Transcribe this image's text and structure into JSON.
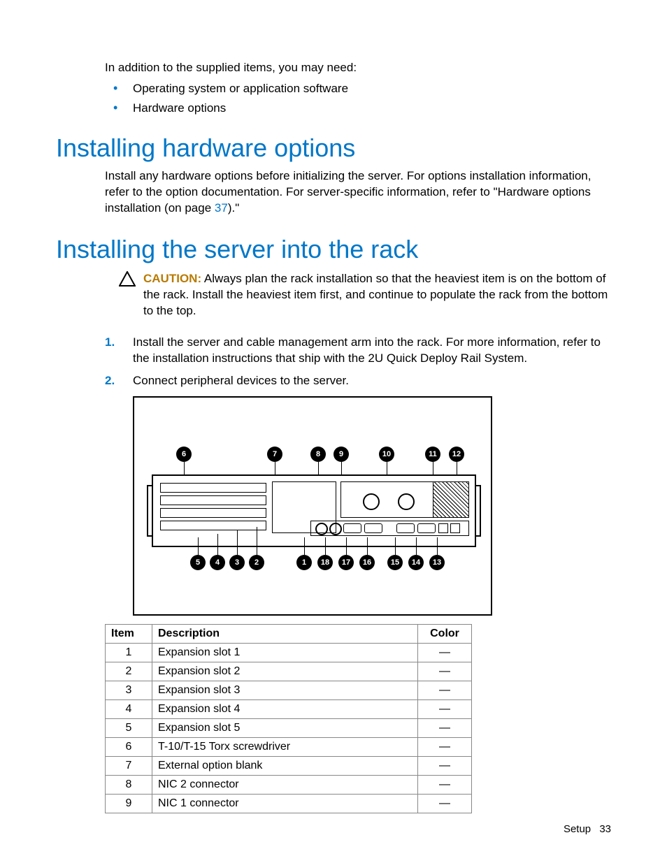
{
  "intro": {
    "lead": "In addition to the supplied items, you may need:",
    "bullets": [
      "Operating system or application software",
      "Hardware options"
    ]
  },
  "section1": {
    "heading": "Installing hardware options",
    "body_a": "Install any hardware options before initializing the server. For options installation information, refer to the option documentation. For server-specific information, refer to \"Hardware options installation (on page ",
    "link": "37",
    "body_b": ").\""
  },
  "section2": {
    "heading": "Installing the server into the rack",
    "caution_label": "CAUTION:",
    "caution_text": " Always plan the rack installation so that the heaviest item is on the bottom of the rack. Install the heaviest item first, and continue to populate the rack from the bottom to the top.",
    "steps": [
      "Install the server and cable management arm into the rack. For more information, refer to the installation instructions that ship with the 2U Quick Deploy Rail System.",
      "Connect peripheral devices to the server."
    ]
  },
  "callouts_top": [
    "6",
    "7",
    "8",
    "9",
    "10",
    "11",
    "12"
  ],
  "callouts_bottom_left": [
    "5",
    "4",
    "3",
    "2"
  ],
  "callouts_bottom_right": [
    "1",
    "18",
    "17",
    "16",
    "15",
    "14",
    "13"
  ],
  "table": {
    "headers": [
      "Item",
      "Description",
      "Color"
    ],
    "rows": [
      {
        "item": "1",
        "desc": "Expansion slot 1",
        "color": "—"
      },
      {
        "item": "2",
        "desc": "Expansion slot 2",
        "color": "—"
      },
      {
        "item": "3",
        "desc": "Expansion slot 3",
        "color": "—"
      },
      {
        "item": "4",
        "desc": "Expansion slot 4",
        "color": "—"
      },
      {
        "item": "5",
        "desc": "Expansion slot 5",
        "color": "—"
      },
      {
        "item": "6",
        "desc": "T-10/T-15 Torx screwdriver",
        "color": "—"
      },
      {
        "item": "7",
        "desc": "External option blank",
        "color": "—"
      },
      {
        "item": "8",
        "desc": "NIC 2 connector",
        "color": "—"
      },
      {
        "item": "9",
        "desc": "NIC 1 connector",
        "color": "—"
      }
    ]
  },
  "footer": {
    "section": "Setup",
    "page": "33"
  }
}
